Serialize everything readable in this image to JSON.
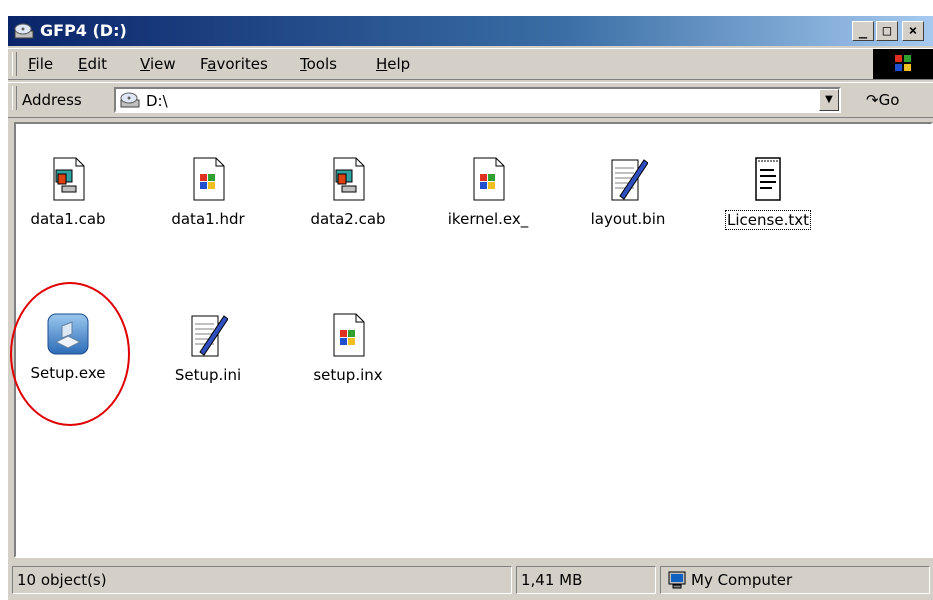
{
  "window": {
    "title": "GFP4 (D:)"
  },
  "caption_buttons": {
    "minimize": "_",
    "maximize": "□",
    "close": "×"
  },
  "menu": [
    {
      "label": "File",
      "accel": "F"
    },
    {
      "label": "Edit",
      "accel": "E"
    },
    {
      "label": "View",
      "accel": "V"
    },
    {
      "label": "Favorites",
      "accel": "a"
    },
    {
      "label": "Tools",
      "accel": "T"
    },
    {
      "label": "Help",
      "accel": "H"
    }
  ],
  "address": {
    "label": "Address",
    "value": "D:\\",
    "go_label": "Go"
  },
  "files": [
    {
      "name": "data1.cab",
      "icon": "cab-file-icon"
    },
    {
      "name": "data1.hdr",
      "icon": "windows-file-icon"
    },
    {
      "name": "data2.cab",
      "icon": "cab-file-icon"
    },
    {
      "name": "ikernel.ex_",
      "icon": "windows-file-icon"
    },
    {
      "name": "layout.bin",
      "icon": "notepad-file-icon"
    },
    {
      "name": "License.txt",
      "icon": "text-file-icon"
    },
    {
      "name": "Setup.exe",
      "icon": "setup-exe-icon"
    },
    {
      "name": "Setup.ini",
      "icon": "notepad-file-icon"
    },
    {
      "name": "setup.inx",
      "icon": "windows-file-icon"
    }
  ],
  "status": {
    "objects": "10 object(s)",
    "size": "1,41 MB",
    "zone": "My Computer"
  },
  "annotation": {
    "color": "#e00000"
  }
}
